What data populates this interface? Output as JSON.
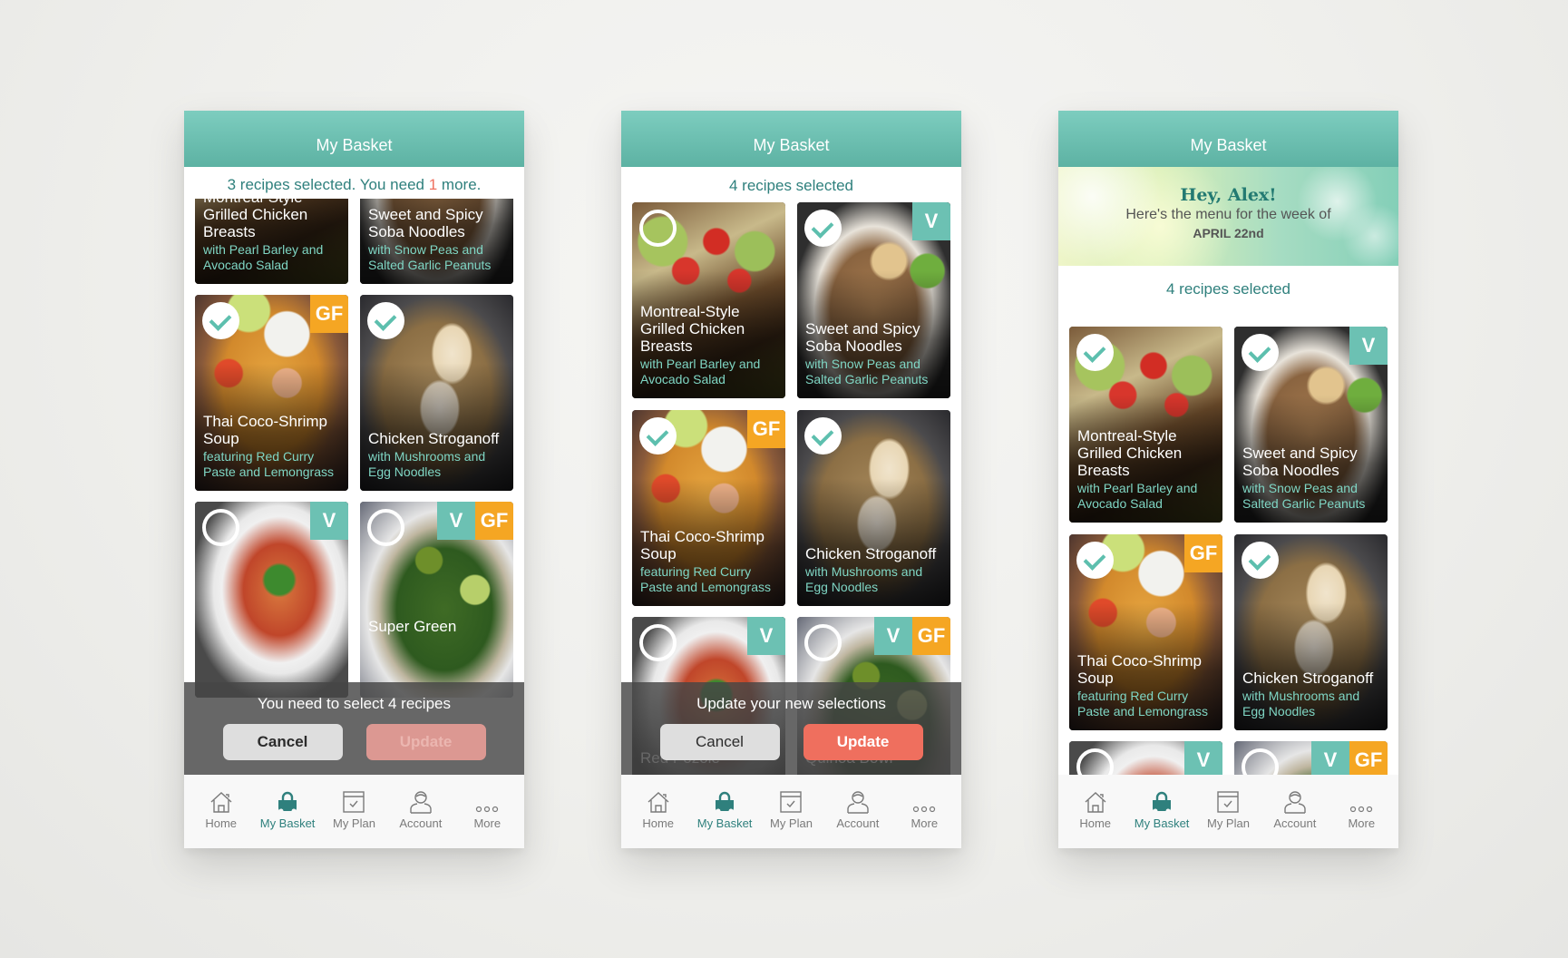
{
  "colors": {
    "header": "#6cc1b3",
    "accent_teal": "#2f807d",
    "vegetarian_badge": "#6cc1b3",
    "gluten_free_badge": "#f5a623",
    "update": "#ef6f5e",
    "cancel": "#dedede"
  },
  "recipes": {
    "chicken": {
      "name": "Montreal-Style Grilled Chicken Breasts",
      "desc": "with Pearl Barley and Avocado Salad"
    },
    "soba": {
      "name": "Sweet and Spicy Soba Noodles",
      "desc": "with Snow Peas and Salted Garlic Peanuts",
      "badges": [
        "V"
      ]
    },
    "thai": {
      "name": "Thai Coco-Shrimp Soup",
      "desc": "featuring Red Curry Paste and Lemongrass",
      "badges": [
        "GF"
      ]
    },
    "strog": {
      "name": "Chicken Stroganoff",
      "desc": "with Mushrooms and Egg Noodles"
    },
    "pozole": {
      "name": "Red Pozole",
      "desc": "",
      "badges": [
        "V"
      ]
    },
    "quinoa": {
      "name": "Super Green Quinoa Bowl",
      "desc": "",
      "badges": [
        "V",
        "GF"
      ]
    }
  },
  "badges": {
    "v": "V",
    "gf": "GF"
  },
  "screens": [
    {
      "title": "My Basket",
      "subtitle_pre": "3 recipes selected. You need ",
      "subtitle_count": "1",
      "subtitle_post": " more.",
      "selected": {
        "chicken": false,
        "soba": false,
        "thai": true,
        "strog": true,
        "pozole": false,
        "quinoa": false
      },
      "partial_name_quinoa": "Super Green",
      "overlay": {
        "message": "You need to select 4 recipes",
        "cancel": "Cancel",
        "update": "Update",
        "update_enabled": false
      }
    },
    {
      "title": "My Basket",
      "subtitle": "4 recipes selected",
      "selected": {
        "chicken": false,
        "soba": true,
        "thai": true,
        "strog": true,
        "pozole": false,
        "quinoa": false
      },
      "overlay": {
        "message": "Update your new selections",
        "cancel": "Cancel",
        "update": "Update",
        "update_enabled": true
      },
      "hidden_names": {
        "pozole": "Red Pozole",
        "quinoa": "Quinoa Bowl"
      }
    },
    {
      "title": "My Basket",
      "banner": {
        "greeting": "Hey, Alex!",
        "line": "Here's the menu for the week of",
        "date": "APRIL 22nd"
      },
      "subtitle": "4 recipes selected",
      "selected": {
        "chicken": true,
        "soba": true,
        "thai": true,
        "strog": true,
        "pozole": false,
        "quinoa": false
      }
    }
  ],
  "nav": [
    {
      "label": "Home",
      "icon": "home-icon",
      "active": false
    },
    {
      "label": "My Basket",
      "icon": "basket-icon",
      "active": true
    },
    {
      "label": "My Plan",
      "icon": "calendar-check-icon",
      "active": false
    },
    {
      "label": "Account",
      "icon": "user-icon",
      "active": false
    },
    {
      "label": "More",
      "icon": "more-dots-icon",
      "active": false
    }
  ]
}
